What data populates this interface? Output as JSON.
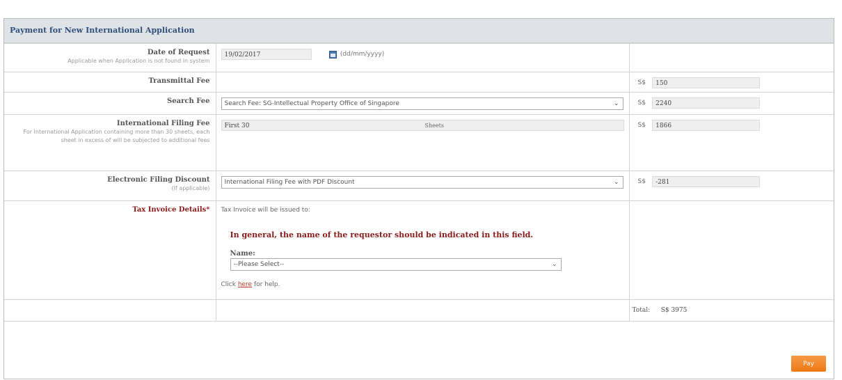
{
  "panel": {
    "title": "Payment for New International Application"
  },
  "rows": {
    "date": {
      "label": "Date of Request",
      "sublabel": "Applicable when Application is not found in system",
      "value": "19/02/2017",
      "format_hint": "(dd/mm/yyyy)"
    },
    "transmittal": {
      "label": "Transmittal Fee",
      "currency": "S$",
      "amount": "150"
    },
    "search": {
      "label": "Search Fee",
      "selected": "Search Fee: SG-Intellectual Property Office of Singapore",
      "currency": "S$",
      "amount": "2240"
    },
    "filing": {
      "label": "International Filing Fee",
      "sublabel": "For International Application containing more than 30 sheets, each sheet in excess of will be subjected to additional fees",
      "sheets_value": "First 30",
      "sheets_unit": "Sheets",
      "currency": "S$",
      "amount": "1866"
    },
    "discount": {
      "label": "Electronic Filing Discount",
      "sublabel": "(If applicable)",
      "selected": "International Filing Fee with PDF Discount",
      "currency": "S$",
      "amount": "-281"
    },
    "tax": {
      "label": "Tax Invoice Details*",
      "intro": "Tax Invoice will be issued to:",
      "warning": "In general, the name of the requestor should be indicated in this field.",
      "name_label": "Name:",
      "name_selected": "--Please Select--",
      "help_prefix": "Click ",
      "help_link": "here",
      "help_suffix": " for help."
    },
    "total": {
      "label": "Total:",
      "value": "S$ 3975"
    }
  },
  "actions": {
    "pay_label": "Pay"
  },
  "colors": {
    "header_bg": "#dfe3e7",
    "accent_orange": "#ee7914",
    "warning_red": "#8b1a1a"
  }
}
